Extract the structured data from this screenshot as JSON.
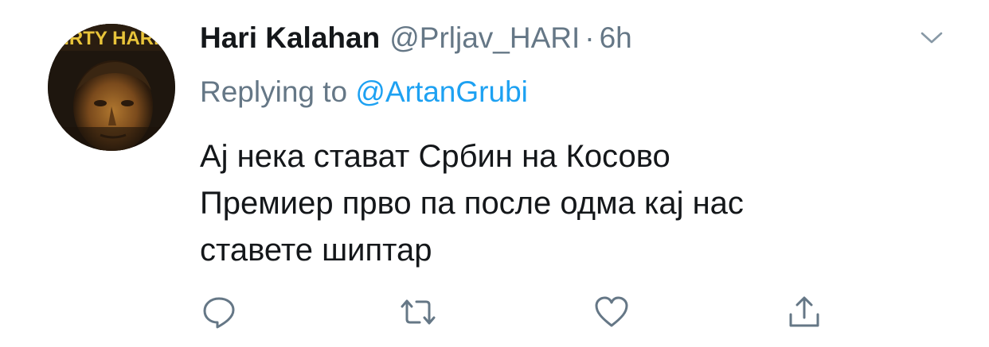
{
  "tweet": {
    "author": {
      "display_name": "Hari Kalahan",
      "handle": "@Prljav_HARI",
      "avatar_text": "IRTY HARI"
    },
    "separator": "·",
    "time": "6h",
    "replying": {
      "prefix": "Replying to",
      "mention": "@ArtanGrubi"
    },
    "body_lines": [
      "Ај нека стават Србин на Косово",
      "Премиер прво па после одма кај нас",
      "ставете шиптар"
    ]
  },
  "icons": {
    "menu": "chevron-down-icon",
    "reply": "comment-icon",
    "retweet": "retweet-icon",
    "like": "heart-icon",
    "share": "share-icon"
  },
  "colors": {
    "text_primary": "#14171a",
    "text_secondary": "#657786",
    "link": "#1da1f2",
    "icon": "#657786"
  }
}
